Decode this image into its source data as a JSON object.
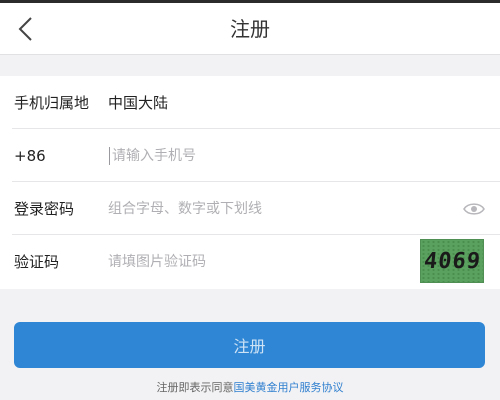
{
  "header": {
    "title": "注册",
    "back_icon": "chevron-left-icon"
  },
  "form": {
    "region": {
      "label": "手机归属地",
      "value": "中国大陆"
    },
    "phone": {
      "prefix": "+86",
      "placeholder": "请输入手机号",
      "value": ""
    },
    "password": {
      "label": "登录密码",
      "placeholder": "组合字母、数字或下划线",
      "value": "",
      "toggle_icon": "eye-icon"
    },
    "captcha": {
      "label": "验证码",
      "placeholder": "请填图片验证码",
      "value": "",
      "image_text": "4069"
    }
  },
  "submit": {
    "label": "注册"
  },
  "agreement": {
    "prefix": "注册即表示同意",
    "link": "国美黄金用户服务协议"
  },
  "colors": {
    "primary": "#2f86d4",
    "link": "#2f7fcf",
    "captcha_bg": "#5aa05e"
  }
}
